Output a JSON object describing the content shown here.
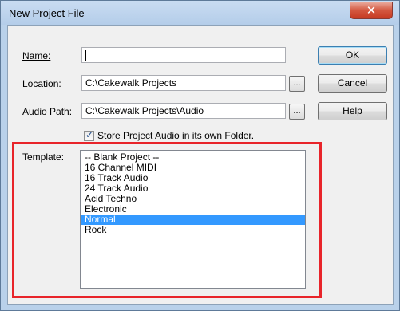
{
  "window": {
    "title": "New Project File",
    "close_glyph": "✕"
  },
  "labels": {
    "name": "Name:",
    "location": "Location:",
    "audio_path": "Audio Path:",
    "template": "Template:"
  },
  "fields": {
    "name_value": "",
    "location_value": "C:\\Cakewalk Projects",
    "audio_path_value": "C:\\Cakewalk Projects\\Audio",
    "browse_label": "..."
  },
  "buttons": {
    "ok": "OK",
    "cancel": "Cancel",
    "help": "Help"
  },
  "store_audio": {
    "label": "Store Project Audio in its own Folder.",
    "checked": true
  },
  "templates": {
    "items": [
      "-- Blank Project --",
      "16 Channel MIDI",
      "16 Track Audio",
      "24 Track Audio",
      "Acid Techno",
      "Electronic",
      "Normal",
      "Rock"
    ],
    "selected": "Normal"
  },
  "colors": {
    "highlight_border": "#e8242a",
    "selection": "#3399ff"
  }
}
